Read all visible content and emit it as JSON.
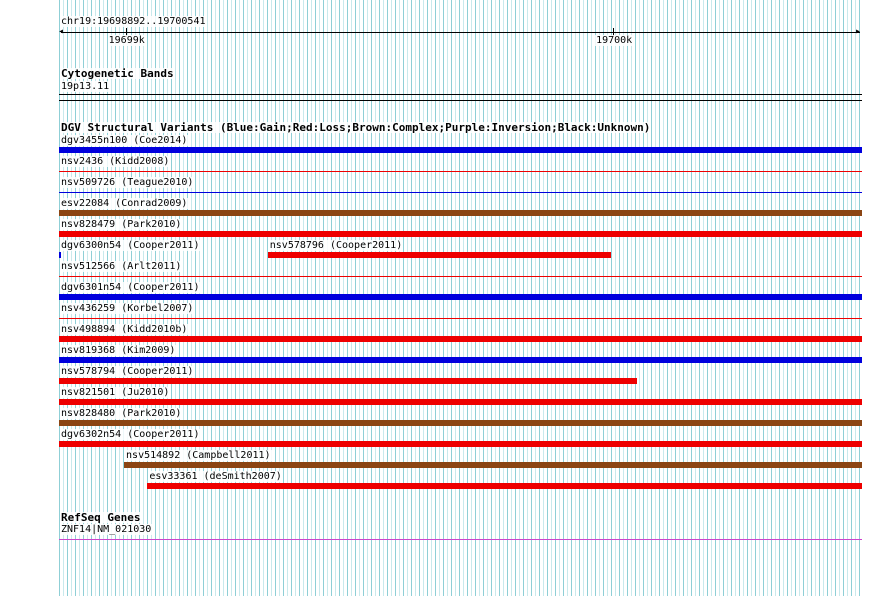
{
  "ruler": {
    "location": "chr19:19698892..19700541",
    "ticks": [
      {
        "label": "19699k",
        "pos": 0.083
      },
      {
        "label": "19700k",
        "pos": 0.69
      }
    ]
  },
  "cytoband": {
    "title": "Cytogenetic Bands",
    "band": "19p13.11"
  },
  "dgv": {
    "title": "DGV Structural Variants (Blue:Gain;Red:Loss;Brown:Complex;Purple:Inversion;Black:Unknown)",
    "colors": {
      "gain": "#0000dd",
      "loss": "#ee0000",
      "complex": "#8b4513",
      "inversion": "#800080",
      "unknown": "#000000"
    },
    "features": [
      {
        "label": "dgv3455n100 (Coe2014)",
        "type": "gain",
        "start": 0.0,
        "end": 1.0,
        "row": 0
      },
      {
        "label": "nsv2436 (Kidd2008)",
        "type": "loss",
        "start": 0.0,
        "end": 1.0,
        "row": 1,
        "thin": true
      },
      {
        "label": "nsv509726 (Teague2010)",
        "type": "gain",
        "start": 0.0,
        "end": 1.0,
        "row": 2,
        "thin": true
      },
      {
        "label": "esv22084 (Conrad2009)",
        "type": "complex",
        "start": 0.0,
        "end": 1.0,
        "row": 3
      },
      {
        "label": "nsv828479 (Park2010)",
        "type": "loss",
        "start": 0.0,
        "end": 1.0,
        "row": 4
      },
      {
        "label": "dgv6300n54 (Cooper2011)",
        "type": "gain",
        "start": 0.0,
        "end": 0.003,
        "row": 5
      },
      {
        "label": "nsv578796 (Cooper2011)",
        "type": "loss",
        "start": 0.26,
        "end": 0.688,
        "row": 5
      },
      {
        "label": "nsv512566 (Arlt2011)",
        "type": "loss",
        "start": 0.0,
        "end": 1.0,
        "row": 6,
        "thin": true
      },
      {
        "label": "dgv6301n54 (Cooper2011)",
        "type": "gain",
        "start": 0.0,
        "end": 1.0,
        "row": 7
      },
      {
        "label": "nsv436259 (Korbel2007)",
        "type": "loss",
        "start": 0.0,
        "end": 1.0,
        "row": 8,
        "thin": true
      },
      {
        "label": "nsv498894 (Kidd2010b)",
        "type": "loss",
        "start": 0.0,
        "end": 1.0,
        "row": 9
      },
      {
        "label": "nsv819368 (Kim2009)",
        "type": "gain",
        "start": 0.0,
        "end": 1.0,
        "row": 10
      },
      {
        "label": "nsv578794 (Cooper2011)",
        "type": "loss",
        "start": 0.0,
        "end": 0.72,
        "row": 11
      },
      {
        "label": "nsv821501 (Ju2010)",
        "type": "loss",
        "start": 0.0,
        "end": 1.0,
        "row": 12
      },
      {
        "label": "nsv828480 (Park2010)",
        "type": "complex",
        "start": 0.0,
        "end": 1.0,
        "row": 13
      },
      {
        "label": "dgv6302n54 (Cooper2011)",
        "type": "loss",
        "start": 0.0,
        "end": 1.0,
        "row": 14
      },
      {
        "label": "nsv514892 (Campbell2011)",
        "type": "complex",
        "start": 0.081,
        "end": 1.0,
        "row": 15
      },
      {
        "label": "esv33361 (deSmith2007)",
        "type": "loss",
        "start": 0.11,
        "end": 1.0,
        "row": 16
      }
    ]
  },
  "refseq": {
    "title": "RefSeq Genes",
    "gene": "ZNF14|NM_021030",
    "color": "#cc44cc"
  }
}
